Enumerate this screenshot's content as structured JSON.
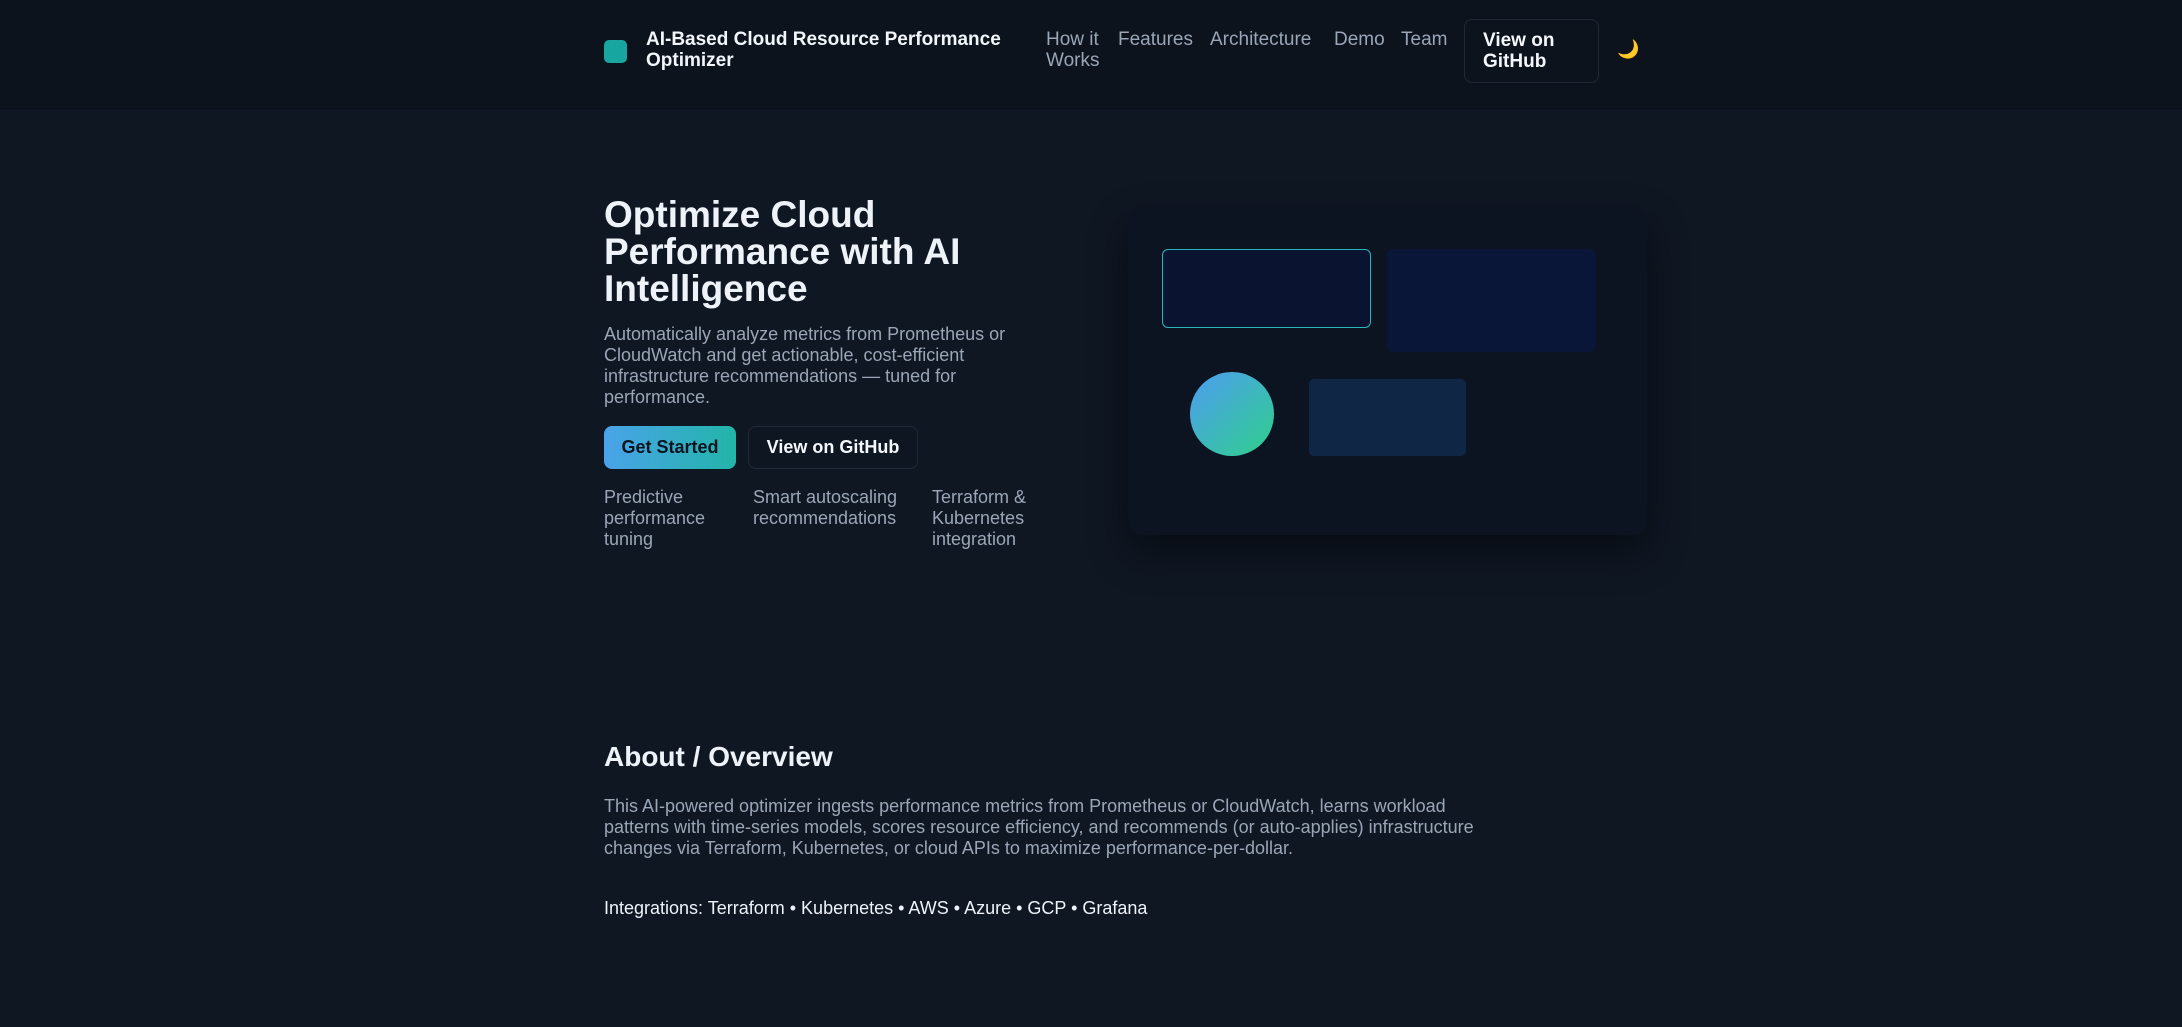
{
  "header": {
    "brand_title": "AI-Based Cloud Resource Performance Optimizer",
    "nav": [
      {
        "label": "How it Works"
      },
      {
        "label": "Features"
      },
      {
        "label": "Architecture"
      },
      {
        "label": "Demo"
      },
      {
        "label": "Team"
      }
    ],
    "github_button": "View on GitHub",
    "theme_toggle_glyph": "🌙"
  },
  "hero": {
    "title": "Optimize Cloud Performance with AI Intelligence",
    "description": "Automatically analyze metrics from Prometheus or CloudWatch and get actionable, cost-efficient infrastructure recommendations — tuned for performance.",
    "primary_button": "Get Started",
    "secondary_button": "View on GitHub",
    "features": [
      "Predictive performance tuning",
      "Smart autoscaling recommendations",
      "Terraform & Kubernetes integration"
    ]
  },
  "about": {
    "title": "About / Overview",
    "body": "This AI-powered optimizer ingests performance metrics from Prometheus or CloudWatch, learns workload patterns with time-series models, scores resource efficiency, and recommends (or auto-applies) infrastructure changes via Terraform, Kubernetes, or cloud APIs to maximize performance-per-dollar.",
    "integrations": "Integrations: Terraform • Kubernetes • AWS • Azure • GCP • Grafana"
  },
  "colors": {
    "background": "#0f1723",
    "header_background": "#0c131d",
    "accent_teal": "#18a6a0",
    "accent_blue": "#4aa3e9",
    "muted_text": "#9aa6b6"
  }
}
